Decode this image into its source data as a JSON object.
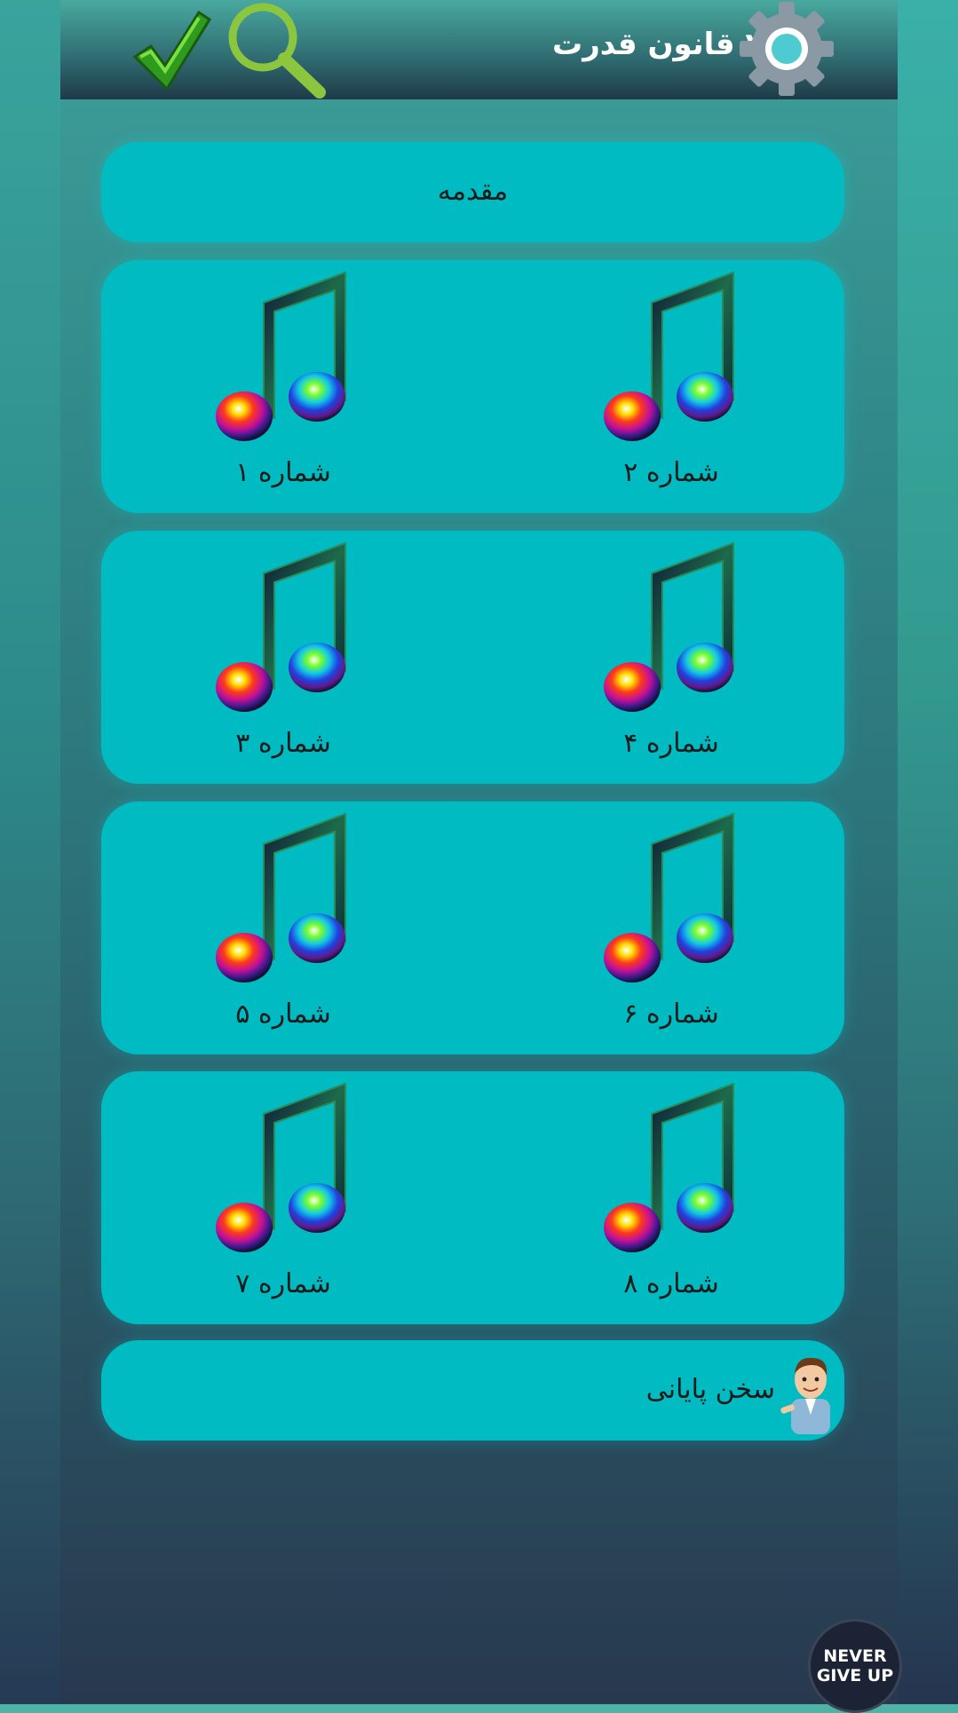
{
  "header": {
    "title": "۴۸ قانون قدرت",
    "icons": [
      "settings-gear-icon",
      "checkmark-icon",
      "search-icon"
    ]
  },
  "intro": {
    "label": "مقدمه"
  },
  "tracks": [
    {
      "label": "شماره ۱"
    },
    {
      "label": "شماره ۲"
    },
    {
      "label": "شماره ۳"
    },
    {
      "label": "شماره ۴"
    },
    {
      "label": "شماره ۵"
    },
    {
      "label": "شماره ۶"
    },
    {
      "label": "شماره ۷"
    },
    {
      "label": "شماره ۸"
    }
  ],
  "ending": {
    "label": "سخن پایانی",
    "icon": "cartoon-man-avatar"
  },
  "badge": {
    "line1": "NEVER",
    "line2": "GIVE UP"
  },
  "colors": {
    "card": "#00bcc2",
    "header": "#2f6a70",
    "accent_green": "#7ac142"
  }
}
